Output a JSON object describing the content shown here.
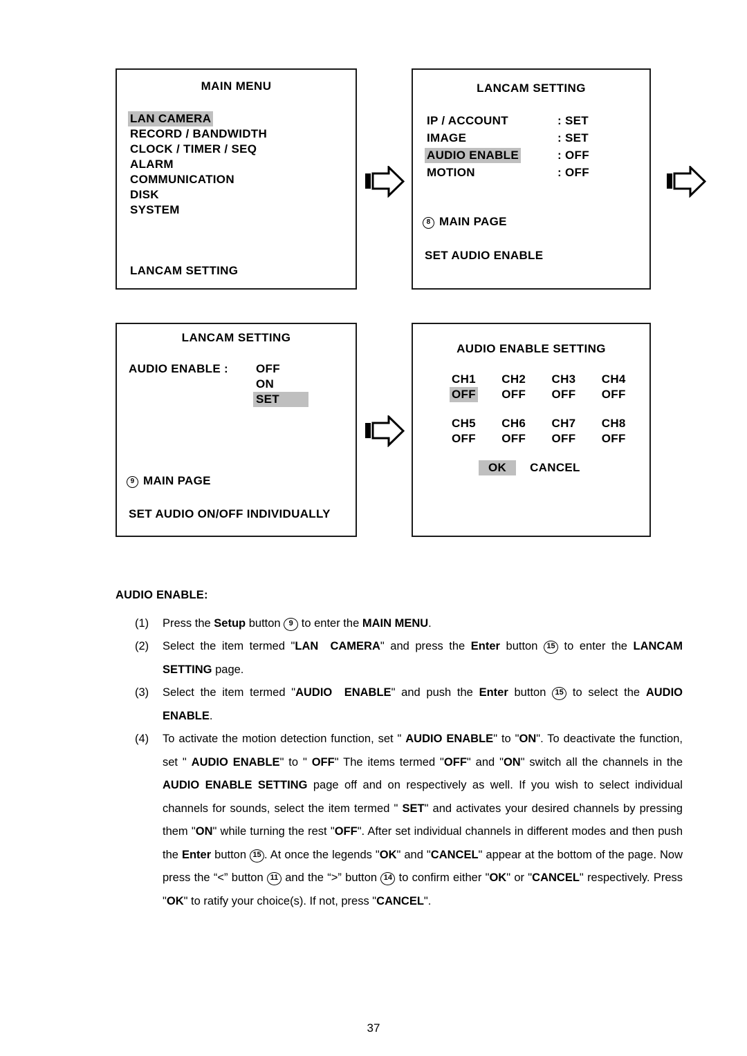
{
  "panels": {
    "main_menu": {
      "title": "MAIN MENU",
      "items": [
        {
          "label": "LAN CAMERA",
          "highlighted": true
        },
        {
          "label": "RECORD / BANDWIDTH",
          "highlighted": false
        },
        {
          "label": "CLOCK / TIMER / SEQ",
          "highlighted": false
        },
        {
          "label": "ALARM",
          "highlighted": false
        },
        {
          "label": "COMMUNICATION",
          "highlighted": false
        },
        {
          "label": "DISK",
          "highlighted": false
        },
        {
          "label": "SYSTEM",
          "highlighted": false
        }
      ],
      "footer": "LANCAM SETTING"
    },
    "lancam_setting": {
      "title": "LANCAM SETTING",
      "rows": [
        {
          "key": "IP / ACCOUNT",
          "value": ": SET",
          "highlighted": false
        },
        {
          "key": "IMAGE",
          "value": ": SET",
          "highlighted": false
        },
        {
          "key": "AUDIO ENABLE",
          "value": ": OFF",
          "highlighted": true
        },
        {
          "key": "MOTION",
          "value": ": OFF",
          "highlighted": false
        }
      ],
      "main_page_num": "8",
      "main_page_label": "MAIN PAGE",
      "hint": "SET AUDIO ENABLE"
    },
    "audio_enable": {
      "title": "LANCAM SETTING",
      "label": "AUDIO ENABLE :",
      "options": [
        {
          "label": "OFF",
          "highlighted": false
        },
        {
          "label": "ON",
          "highlighted": false
        },
        {
          "label": "SET",
          "highlighted": true
        }
      ],
      "main_page_num": "9",
      "main_page_label": "MAIN PAGE",
      "hint": "SET AUDIO ON/OFF INDIVIDUALLY"
    },
    "audio_enable_setting": {
      "title": "AUDIO ENABLE SETTING",
      "row1_channels": [
        "CH1",
        "CH2",
        "CH3",
        "CH4"
      ],
      "row1_values": [
        {
          "label": "OFF",
          "highlighted": true
        },
        {
          "label": "OFF",
          "highlighted": false
        },
        {
          "label": "OFF",
          "highlighted": false
        },
        {
          "label": "OFF",
          "highlighted": false
        }
      ],
      "row2_channels": [
        "CH5",
        "CH6",
        "CH7",
        "CH8"
      ],
      "row2_values": [
        {
          "label": "OFF",
          "highlighted": false
        },
        {
          "label": "OFF",
          "highlighted": false
        },
        {
          "label": "OFF",
          "highlighted": false
        },
        {
          "label": "OFF",
          "highlighted": false
        }
      ],
      "ok_label": "OK",
      "ok_highlighted": true,
      "cancel_label": "CANCEL"
    }
  },
  "arrows": {
    "icon_name": "right-arrow-icon",
    "count": 3
  },
  "body": {
    "section_title": "AUDIO ENABLE:",
    "steps": [
      {
        "num": "(1)",
        "html": "Press the <b>Setup</b> button <span class=\"cnum\">9</span> to enter the <b>MAIN MENU</b>."
      },
      {
        "num": "(2)",
        "html": "Select the item termed \"<b>LAN&nbsp; CAMERA</b>\" and press the <b>Enter</b> button <span class=\"cnum\">15</span> to enter the <b>LANCAM SETTING</b> page."
      },
      {
        "num": "(3)",
        "html": "Select the item termed \"<b>AUDIO&nbsp; ENABLE</b>\" and push the <b>Enter</b> button <span class=\"cnum\">15</span> to select the <b>AUDIO ENABLE</b>."
      },
      {
        "num": "(4)",
        "html": "To activate the motion detection function, set \" <b>AUDIO ENABLE</b>\" to \"<b>ON</b>\". To deactivate the function, set \" <b>AUDIO ENABLE</b>\" to \" <b>OFF</b>\" The items termed \"<b>OFF</b>\" and \"<b>ON</b>\" switch all the channels in the <b>AUDIO ENABLE SETTING</b> page off and on respectively as well. If you wish to select individual channels for sounds, select the item termed \" <b>SET</b>\" and activates your desired channels by pressing them \"<b>ON</b>\" while turning the rest \"<b>OFF</b>\". After set individual channels in different modes and then push the <b>Enter</b> button <span class=\"cnum\">15</span>. At once the legends \"<b>OK</b>\" and \"<b>CANCEL</b>\" appear at the bottom of the page. Now press the &ldquo;&lt;&rdquo; button <span class=\"cnum\">11</span> and the &ldquo;&gt;&rdquo; button <span class=\"cnum\">14</span> to confirm either \"<b>OK</b>\" or \"<b>CANCEL</b>\" respectively. Press \"<b>OK</b>\" to ratify your choice(s). If not, press \"<b>CANCEL</b>\"."
      }
    ]
  },
  "page_number": "37"
}
